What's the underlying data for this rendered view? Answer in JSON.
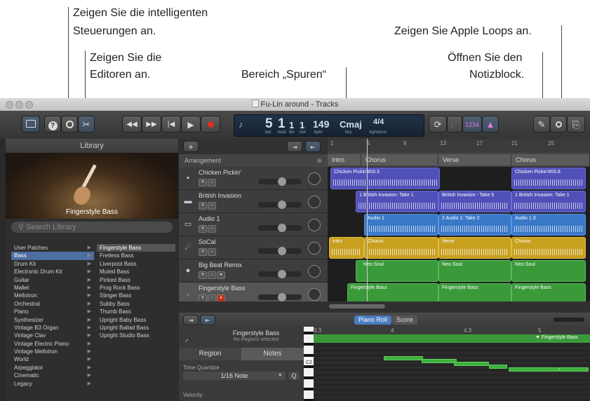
{
  "annotations": {
    "smart_controls_1": "Zeigen Sie die intelligenten",
    "smart_controls_2": "Steuerungen an.",
    "editors_1": "Zeigen Sie die",
    "editors_2": "Editoren an.",
    "tracks_area": "Bereich „Spuren“",
    "apple_loops": "Zeigen Sie Apple Loops an.",
    "notepad_1": "Öffnen Sie den",
    "notepad_2": "Notizblock."
  },
  "window": {
    "title": "Fu-Lin around - Tracks"
  },
  "toolbar": {
    "library_icon": "library-icon",
    "help_label": "?",
    "lcd": {
      "bar": "5",
      "beat": "1",
      "div": "1",
      "tick": "1",
      "bar_label": "bar",
      "beat_label": "beat",
      "div_label": "div",
      "tick_label": "tick",
      "tempo": "149",
      "tempo_label": "bpm",
      "key": "Cmaj",
      "key_label": "key",
      "signature": "4/4",
      "signature_label": "signature"
    },
    "count_in": "1234"
  },
  "library": {
    "header": "Library",
    "image_caption": "Fingerstyle Bass",
    "search_placeholder": "Search Library",
    "categories": [
      "User Patches",
      "Bass",
      "Drum Kit",
      "Electronic Drum Kit",
      "Guitar",
      "Mallet",
      "Mellotron",
      "Orchestral",
      "Piano",
      "Synthesizer",
      "Vintage B3 Organ",
      "Vintage Clav",
      "Vintage Electric Piano",
      "Vintage Mellotron",
      "World",
      "Arpeggiator",
      "Cinematic",
      "Legacy"
    ],
    "selected_category": "Bass",
    "sounds": [
      "Fingerstyle Bass",
      "Fretless Bass",
      "Liverpool Bass",
      "Muted Bass",
      "Picked Bass",
      "Prog Rock Bass",
      "Stinger Bass",
      "Subby Bass",
      "Thumb Bass",
      "Upright Baby Bass",
      "Upright Ballad Bass",
      "Upright Studio Bass"
    ],
    "selected_sound": "Fingerstyle Bass"
  },
  "tracks": {
    "add_label": "+",
    "arrangement_label": "Arrangement",
    "items": [
      {
        "name": "Chicken Pickin'"
      },
      {
        "name": "British Invasion"
      },
      {
        "name": "Audio 1"
      },
      {
        "name": "SoCal"
      },
      {
        "name": "Big Beat Remix"
      },
      {
        "name": "Fingerstyle Bass"
      }
    ]
  },
  "ruler": {
    "marks": [
      "1",
      "5",
      "9",
      "13",
      "17",
      "21",
      "25"
    ]
  },
  "markers": [
    "Intro",
    "Chorus",
    "Verse",
    "Chorus"
  ],
  "regions": {
    "r1": "Chicken Pickin'#03.3",
    "r2": "Chicken Pickin'#03.8",
    "r3": "1  British Invasion: Take 1",
    "r4": "British Invasion - Take 5",
    "r5": "1  British Invasion: Take 1",
    "r6": "Audio 1",
    "r7": "2  Audio 1: Take 2",
    "r8": "Audio 1.3",
    "r9": "Intro",
    "r10": "Chorus",
    "r11": "Verse",
    "r12": "Chorus",
    "r13": "Neo Soul",
    "r14": "Neo Soul",
    "r15": "Neo Soul",
    "r16": "Fingerstyle Bass",
    "r17": "Fingerstyle Bass",
    "r18": "Fingerstyle Bass"
  },
  "editor": {
    "piano_roll_label": "Piano Roll",
    "score_label": "Score",
    "track_name": "Fingerstyle Bass",
    "track_sub": "No Regions selected",
    "tab_region": "Region",
    "tab_notes": "Notes",
    "time_quantize_label": "Time Quantize",
    "quantize_value": "1/16 Note",
    "q_label": "Q",
    "velocity_label": "Velocity",
    "c2_label": "C2",
    "ruler": [
      "3.3",
      "4",
      "4.3",
      "5"
    ],
    "region_name": "Fingerstyle Bass"
  }
}
